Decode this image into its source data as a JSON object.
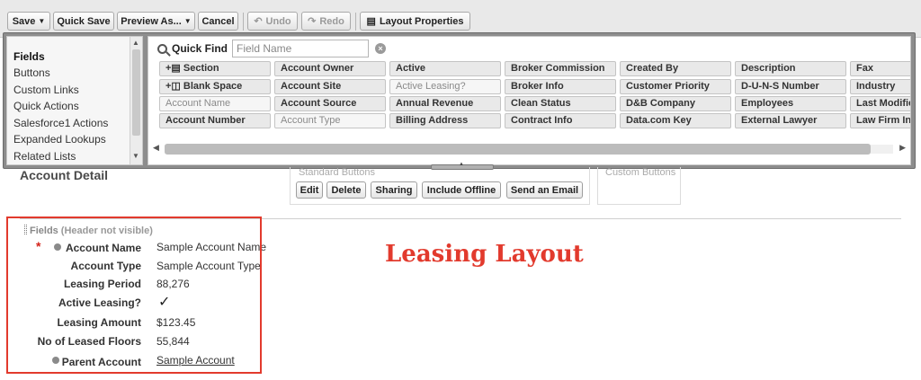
{
  "toolbar": {
    "save": "Save",
    "quick_save": "Quick Save",
    "preview_as": "Preview As...",
    "cancel": "Cancel",
    "undo": "Undo",
    "redo": "Redo",
    "layout_properties": "Layout Properties"
  },
  "palette": {
    "categories": [
      "Fields",
      "Buttons",
      "Custom Links",
      "Quick Actions",
      "Salesforce1 Actions",
      "Expanded Lookups",
      "Related Lists"
    ],
    "active_category": "Fields",
    "quick_find_label": "Quick Find",
    "quick_find_placeholder": "Field Name",
    "tiles": [
      [
        "Section",
        "Account Owner",
        "Active",
        "Broker Commission",
        "Created By",
        "Description",
        "Fax"
      ],
      [
        "Blank Space",
        "Account Site",
        "Active Leasing?",
        "Broker Info",
        "Customer Priority",
        "D-U-N-S Number",
        "Industry"
      ],
      [
        "Account Name",
        "Account Source",
        "Annual Revenue",
        "Clean Status",
        "D&B Company",
        "Employees",
        "Last Modified By"
      ],
      [
        "Account Number",
        "Account Type",
        "Billing Address",
        "Contract Info",
        "Data.com Key",
        "External Lawyer",
        "Law Firm Info"
      ]
    ]
  },
  "canvas": {
    "detail_title": "Account Detail",
    "standard_buttons_label": "Standard Buttons",
    "custom_buttons_label": "Custom Buttons",
    "standard_buttons": [
      "Edit",
      "Delete",
      "Sharing",
      "Include Offline",
      "Send an Email"
    ],
    "section_title": "Fields",
    "section_note": "(Header not visible)",
    "fields": [
      {
        "label": "Account Name",
        "value": "Sample Account Name"
      },
      {
        "label": "Account Type",
        "value": "Sample Account Type"
      },
      {
        "label": "Leasing Period",
        "value": "88,276"
      },
      {
        "label": "Active Leasing?",
        "value": ""
      },
      {
        "label": "Leasing Amount",
        "value": "$123.45"
      },
      {
        "label": "No of Leased Floors",
        "value": "55,844"
      },
      {
        "label": "Parent Account",
        "value": "Sample Account"
      }
    ]
  },
  "annotation": "Leasing Layout",
  "colors": {
    "annotation": "#e23a2d",
    "required": "#d4231a"
  }
}
